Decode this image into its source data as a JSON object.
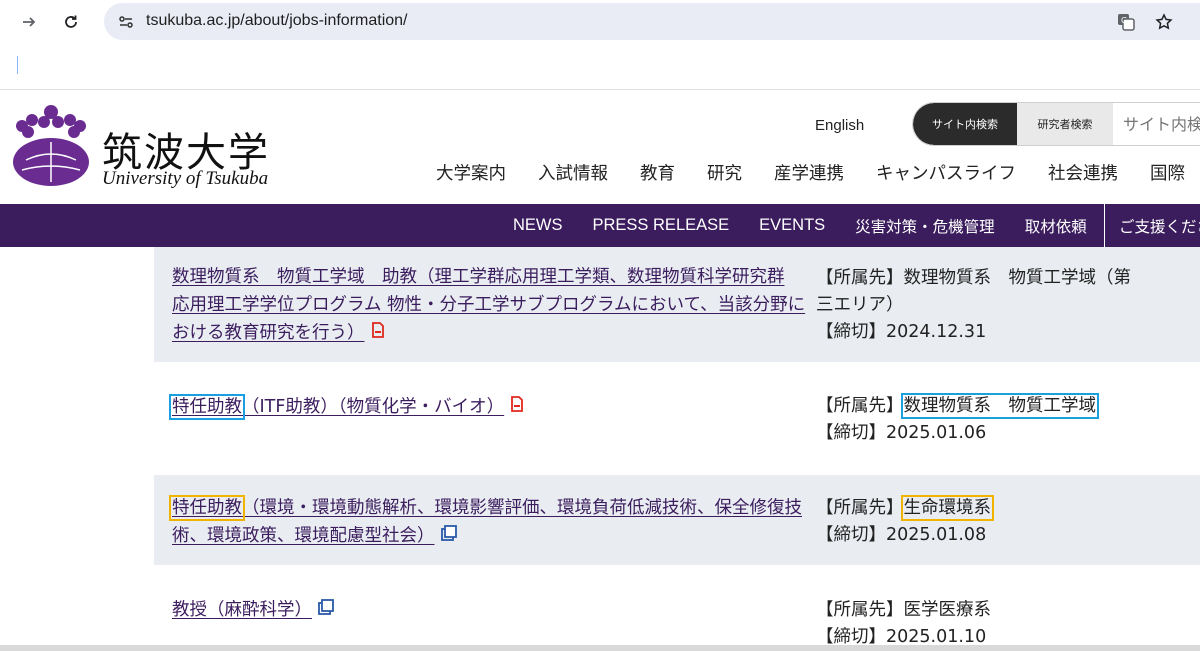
{
  "browser": {
    "url": "tsukuba.ac.jp/about/jobs-information/"
  },
  "header": {
    "logo_jp": "筑波大学",
    "logo_en": "University of Tsukuba",
    "lang_link": "English",
    "search_tab_site": "サイト内検索",
    "search_tab_researcher": "研究者検索",
    "search_placeholder": "サイト内検",
    "main_nav": [
      "大学案内",
      "入試情報",
      "教育",
      "研究",
      "産学連携",
      "キャンパスライフ",
      "社会連携",
      "国際"
    ]
  },
  "subnav": {
    "items": [
      "NEWS",
      "PRESS RELEASE",
      "EVENTS",
      "災害対策・危機管理",
      "取材依頼"
    ],
    "support": "ご支援くださ"
  },
  "jobs": [
    {
      "title_lines": [
        "数理物質系　物質工学域　助教（理工学群応用理工学類、数理物質科学研究群",
        "応用理工学学位プログラム 物性・分子工学サブプログラムにおいて、当該分野に",
        "おける教育研究を行う）"
      ],
      "icon": "pdf-icon",
      "affiliation_lines": [
        "【所属先】数理物質系　物質工学域（第",
        "三エリア）"
      ],
      "deadline": "【締切】2024.12.31"
    },
    {
      "title_highlight": "特任助教",
      "title_rest": "（ITF助教）（物質化学・バイオ）",
      "icon": "pdf-icon",
      "affiliation_label": "【所属先】",
      "affiliation_value": "数理物質系　物質工学域",
      "deadline": "【締切】2025.01.06"
    },
    {
      "title_highlight": "特任助教",
      "title_rest_line1": "（環境・環境動態解析、環境影響評価、環境負荷低減技術、保全修復技",
      "title_rest_line2": "術、環境政策、環境配慮型社会）",
      "icon": "external-link-icon",
      "affiliation_label": "【所属先】",
      "affiliation_value": "生命環境系",
      "deadline": "【締切】2025.01.08"
    },
    {
      "title": "教授（麻酔科学）",
      "icon": "external-link-icon",
      "affiliation": "【所属先】医学医療系",
      "deadline": "【締切】2025.01.10"
    }
  ],
  "colors": {
    "purple": "#3b1d5e",
    "highlight_blue": "#1aa0e0",
    "highlight_yellow": "#f0b400",
    "pdf_red": "#e0281e",
    "ext_blue": "#2a5aa8"
  }
}
